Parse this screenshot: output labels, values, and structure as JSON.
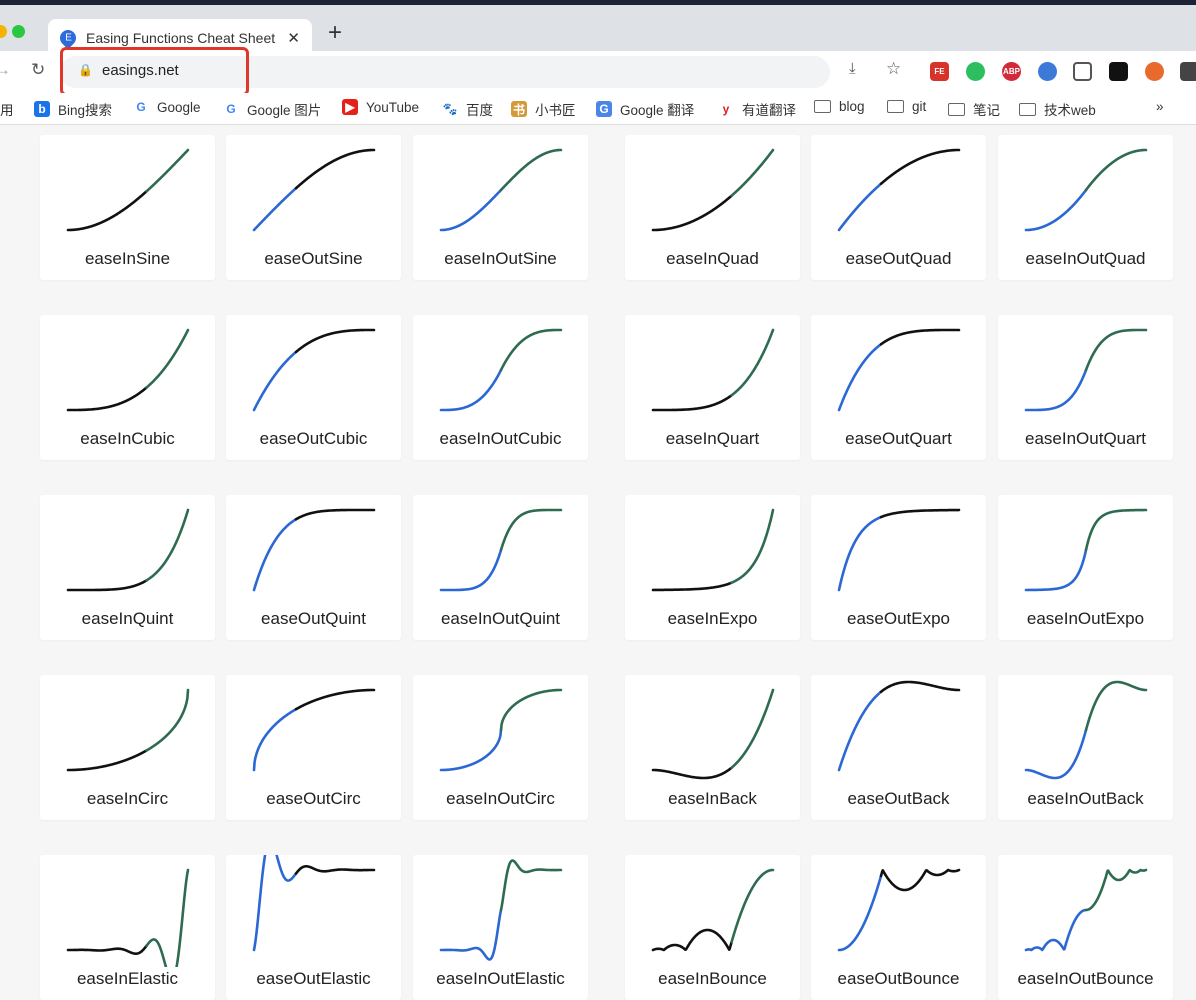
{
  "browser": {
    "tab_title": "Easing Functions Cheat Sheet",
    "tab_favicon_letter": "E",
    "new_tab": "+",
    "url": "easings.net",
    "highlight_color": "#e0372a",
    "extensions": [
      "FE",
      "evernote",
      "ABP",
      "search-ext",
      "tv",
      "tampermonkey",
      "ublock",
      "puzzle"
    ],
    "bookmarks": [
      {
        "label": "用",
        "icon": "apps-icon"
      },
      {
        "label": "Bing搜索",
        "icon": "bing-icon"
      },
      {
        "label": "Google",
        "icon": "google-icon"
      },
      {
        "label": "Google 图片",
        "icon": "google-icon"
      },
      {
        "label": "YouTube",
        "icon": "youtube-icon"
      },
      {
        "label": "百度",
        "icon": "baidu-icon"
      },
      {
        "label": "小书匠",
        "icon": "xiaoshujiang-icon"
      },
      {
        "label": "Google 翻译",
        "icon": "google-translate-icon"
      },
      {
        "label": "有道翻译",
        "icon": "youdao-icon"
      },
      {
        "label": "blog",
        "icon": "folder-icon"
      },
      {
        "label": "git",
        "icon": "folder-icon"
      },
      {
        "label": "笔记",
        "icon": "folder-icon"
      },
      {
        "label": "技术web",
        "icon": "folder-icon"
      }
    ],
    "more": "»"
  },
  "colors": {
    "in": "#2e6b50",
    "out": "#2b68d4",
    "mid": "#111111"
  },
  "easings": [
    "easeInSine",
    "easeOutSine",
    "easeInOutSine",
    "easeInQuad",
    "easeOutQuad",
    "easeInOutQuad",
    "easeInCubic",
    "easeOutCubic",
    "easeInOutCubic",
    "easeInQuart",
    "easeOutQuart",
    "easeInOutQuart",
    "easeInQuint",
    "easeOutQuint",
    "easeInOutQuint",
    "easeInExpo",
    "easeOutExpo",
    "easeInOutExpo",
    "easeInCirc",
    "easeOutCirc",
    "easeInOutCirc",
    "easeInBack",
    "easeOutBack",
    "easeInOutBack",
    "easeInElastic",
    "easeOutElastic",
    "easeInOutElastic",
    "easeInBounce",
    "easeOutBounce",
    "easeInOutBounce"
  ]
}
